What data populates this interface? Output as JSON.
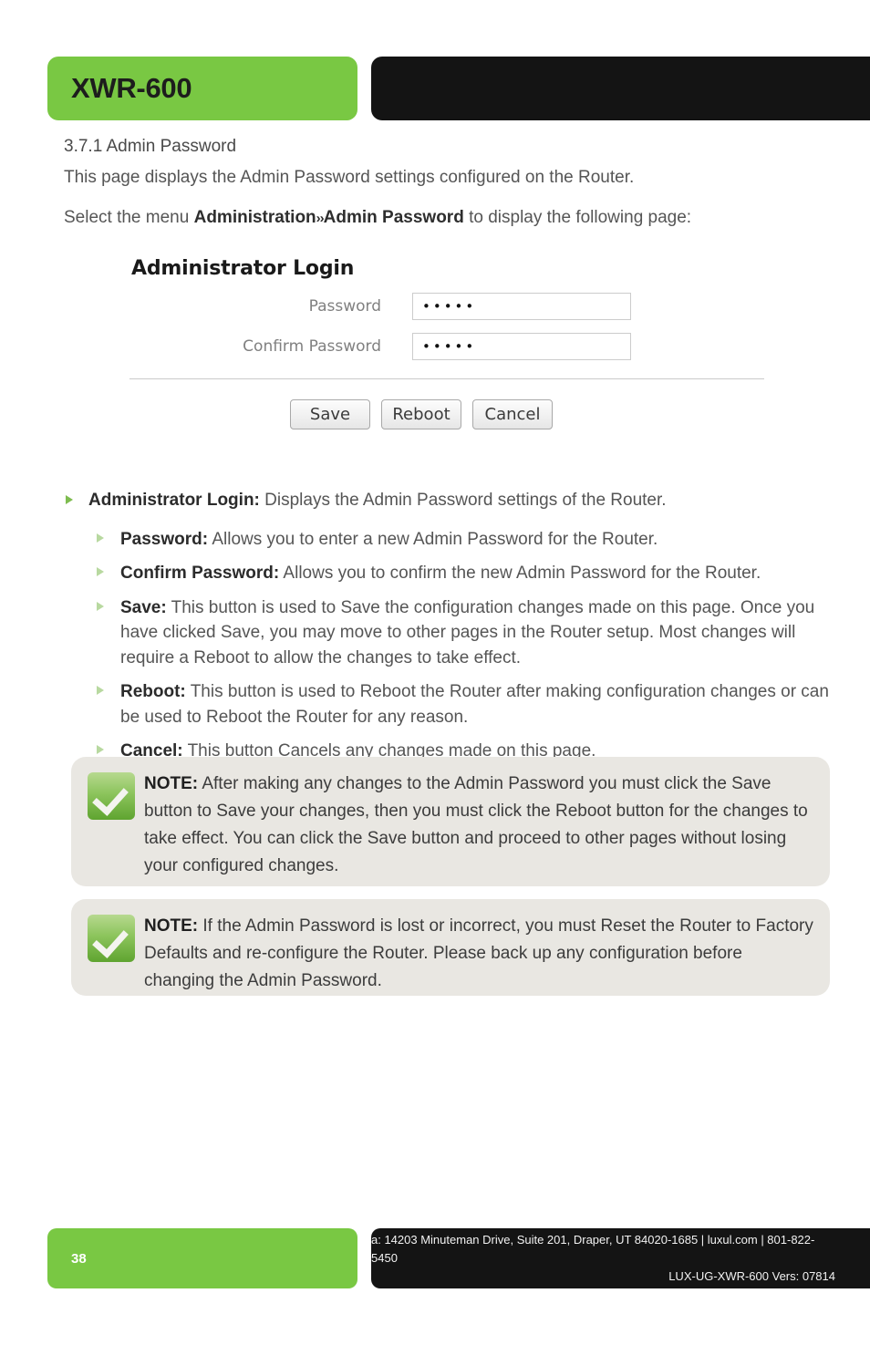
{
  "header": {
    "product": "XWR-600"
  },
  "content": {
    "section_number_title": "3.7.1 Admin Password",
    "intro_line_1": "This page displays the Admin Password settings configured on the Router.",
    "intro_line_2_pre": "Select the menu ",
    "intro_line_2_bold_a": "Administration",
    "intro_line_2_chevrons": "››",
    "intro_line_2_bold_b": "Admin Password",
    "intro_line_2_post": " to display the following page:"
  },
  "router_ui": {
    "heading": "Administrator Login",
    "fields": [
      {
        "label": "Password",
        "value": "•••••"
      },
      {
        "label": "Confirm Password",
        "value": "•••••"
      }
    ],
    "buttons": [
      {
        "label": "Save"
      },
      {
        "label": "Reboot"
      },
      {
        "label": "Cancel"
      }
    ]
  },
  "bullets": {
    "primary": {
      "term": "Administrator Login:",
      "text": " Displays the Admin Password settings of the Router."
    },
    "secondary": [
      {
        "term": "Password:",
        "text": " Allows you to enter a new Admin Password for the Router."
      },
      {
        "term": "Confirm Password:",
        "text": " Allows you to confirm the new Admin Password for the Router."
      },
      {
        "term": "Save:",
        "text": " This button is used to Save the configuration changes made on this page. Once you have clicked Save, you may move to other pages in the Router setup. Most changes will require a Reboot to allow the changes to take effect."
      },
      {
        "term": "Reboot:",
        "text": " This button is used to Reboot the Router after making configuration changes or can be used to Reboot the Router for any reason."
      },
      {
        "term": "Cancel:",
        "text": " This button Cancels any changes made on this page."
      }
    ]
  },
  "notes": [
    {
      "label": "NOTE:",
      "text": " After making any changes to the Admin Password you must click the Save button to Save your changes, then you must click the Reboot button for the changes to take effect. You can click the Save button and proceed to other pages without losing your configured changes."
    },
    {
      "label": "NOTE:",
      "text": " If the Admin Password is lost or incorrect, you must Reset the Router to Factory Defaults and re-configure the Router. Please back up any configuration before changing the Admin Password."
    }
  ],
  "footer": {
    "page_number": "38",
    "address_line": "a: 14203 Minuteman Drive, Suite 201, Draper, UT 84020-1685 | luxul.com | 801-822-5450",
    "doc_line": "LUX-UG-XWR-600  Vers: 07814"
  },
  "colors": {
    "brand_green": "#79c843",
    "brand_black": "#141414",
    "note_bg": "#e9e7e2",
    "body_text": "#555555"
  }
}
